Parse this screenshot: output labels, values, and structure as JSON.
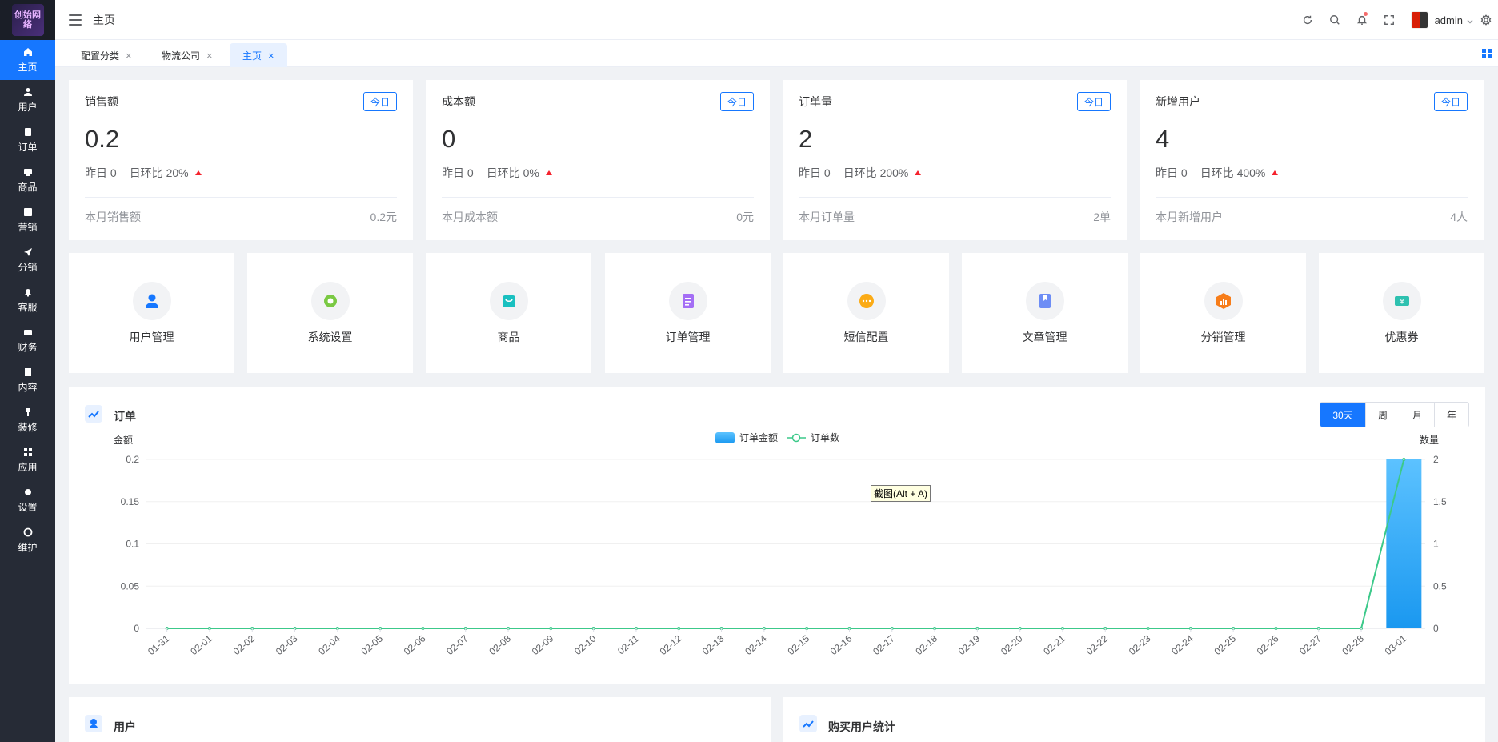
{
  "app": {
    "logo_text": "创始网络"
  },
  "sidebar": {
    "items": [
      {
        "label": "主页",
        "icon": "home-icon"
      },
      {
        "label": "用户",
        "icon": "user-icon"
      },
      {
        "label": "订单",
        "icon": "order-icon"
      },
      {
        "label": "商品",
        "icon": "goods-icon"
      },
      {
        "label": "营销",
        "icon": "marketing-icon"
      },
      {
        "label": "分销",
        "icon": "send-icon"
      },
      {
        "label": "客服",
        "icon": "bell-icon"
      },
      {
        "label": "财务",
        "icon": "wallet-icon"
      },
      {
        "label": "内容",
        "icon": "book-icon"
      },
      {
        "label": "装修",
        "icon": "brush-icon"
      },
      {
        "label": "应用",
        "icon": "apps-icon"
      },
      {
        "label": "设置",
        "icon": "gear-icon"
      },
      {
        "label": "维护",
        "icon": "maintenance-icon"
      }
    ]
  },
  "header": {
    "title": "主页",
    "username": "admin"
  },
  "tabs": [
    {
      "label": "配置分类"
    },
    {
      "label": "物流公司"
    },
    {
      "label": "主页"
    }
  ],
  "stats": [
    {
      "title": "销售额",
      "badge": "今日",
      "value": "0.2",
      "yesterday": "昨日 0",
      "ratio": "日环比 20%",
      "foot_label": "本月销售额",
      "foot_value": "0.2元"
    },
    {
      "title": "成本额",
      "badge": "今日",
      "value": "0",
      "yesterday": "昨日 0",
      "ratio": "日环比 0%",
      "foot_label": "本月成本额",
      "foot_value": "0元"
    },
    {
      "title": "订单量",
      "badge": "今日",
      "value": "2",
      "yesterday": "昨日 0",
      "ratio": "日环比 200%",
      "foot_label": "本月订单量",
      "foot_value": "2单"
    },
    {
      "title": "新增用户",
      "badge": "今日",
      "value": "4",
      "yesterday": "昨日 0",
      "ratio": "日环比 400%",
      "foot_label": "本月新增用户",
      "foot_value": "4人"
    }
  ],
  "quick_entries": [
    {
      "label": "用户管理",
      "icon": "user-manage-icon",
      "color": "#1677ff"
    },
    {
      "label": "系统设置",
      "icon": "settings-icon",
      "color": "#7ac943"
    },
    {
      "label": "商品",
      "icon": "shop-bag-icon",
      "color": "#19c0c0"
    },
    {
      "label": "订单管理",
      "icon": "order-doc-icon",
      "color": "#a46ef5"
    },
    {
      "label": "短信配置",
      "icon": "sms-icon",
      "color": "#fbab16"
    },
    {
      "label": "文章管理",
      "icon": "article-icon",
      "color": "#6d8df5"
    },
    {
      "label": "分销管理",
      "icon": "distribution-icon",
      "color": "#f77d1a"
    },
    {
      "label": "优惠券",
      "icon": "coupon-icon",
      "color": "#2ec1b0"
    }
  ],
  "order_panel": {
    "title": "订单",
    "ranges": [
      "30天",
      "周",
      "月",
      "年"
    ],
    "active_range": "30天"
  },
  "chart_data": {
    "type": "bar",
    "categories": [
      "01-31",
      "02-01",
      "02-02",
      "02-03",
      "02-04",
      "02-05",
      "02-06",
      "02-07",
      "02-08",
      "02-09",
      "02-10",
      "02-11",
      "02-12",
      "02-13",
      "02-14",
      "02-15",
      "02-16",
      "02-17",
      "02-18",
      "02-19",
      "02-20",
      "02-21",
      "02-22",
      "02-23",
      "02-24",
      "02-25",
      "02-26",
      "02-27",
      "02-28",
      "03-01"
    ],
    "series": [
      {
        "name": "订单金额",
        "type": "bar",
        "axis": "left",
        "color": "#3aa8ff",
        "values": [
          0,
          0,
          0,
          0,
          0,
          0,
          0,
          0,
          0,
          0,
          0,
          0,
          0,
          0,
          0,
          0,
          0,
          0,
          0,
          0,
          0,
          0,
          0,
          0,
          0,
          0,
          0,
          0,
          0,
          0.2
        ]
      },
      {
        "name": "订单数",
        "type": "line",
        "axis": "right",
        "color": "#3cc98a",
        "values": [
          0,
          0,
          0,
          0,
          0,
          0,
          0,
          0,
          0,
          0,
          0,
          0,
          0,
          0,
          0,
          0,
          0,
          0,
          0,
          0,
          0,
          0,
          0,
          0,
          0,
          0,
          0,
          0,
          0,
          2
        ]
      }
    ],
    "ylabel_left": "金额",
    "ylabel_right": "数量",
    "yticks_left": [
      "0",
      "0.05",
      "0.1",
      "0.15",
      "0.2"
    ],
    "yticks_right": [
      "0",
      "0.5",
      "1",
      "1.5",
      "2"
    ],
    "ylim_left": [
      0,
      0.2
    ],
    "ylim_right": [
      0,
      2
    ],
    "legend_position": "top-center"
  },
  "tooltip": {
    "text": "截图(Alt + A)"
  },
  "bottom_panels": [
    {
      "title": "用户"
    },
    {
      "title": "购买用户统计"
    }
  ]
}
